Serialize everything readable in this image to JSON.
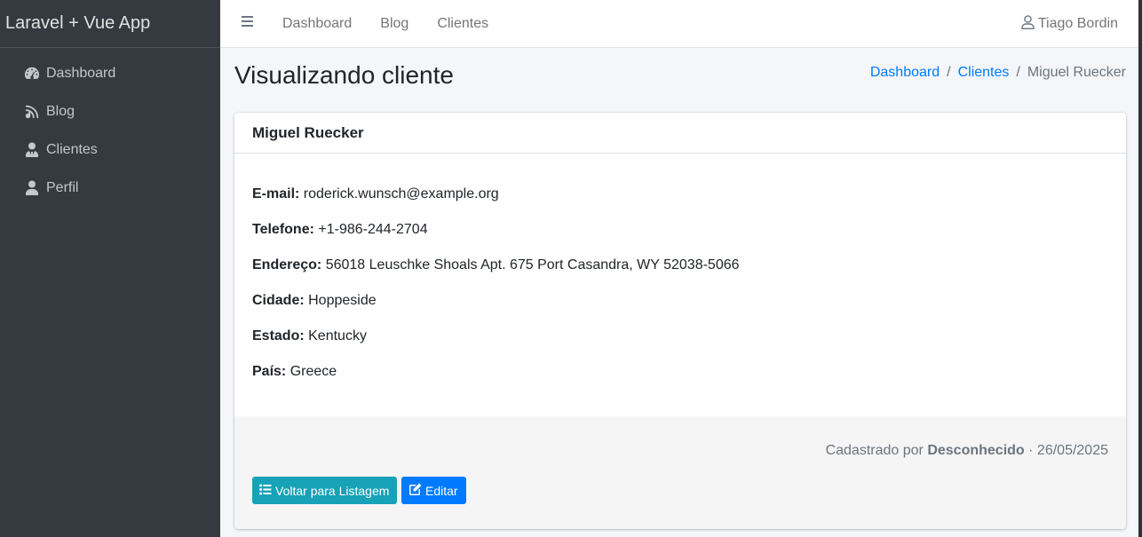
{
  "brand": "Laravel + Vue App",
  "sidebar": {
    "items": [
      {
        "label": "Dashboard",
        "icon": "tachometer-icon"
      },
      {
        "label": "Blog",
        "icon": "blog-icon"
      },
      {
        "label": "Clientes",
        "icon": "user-tie-icon"
      },
      {
        "label": "Perfil",
        "icon": "user-icon"
      }
    ]
  },
  "topnav": {
    "links": [
      "Dashboard",
      "Blog",
      "Clientes"
    ],
    "user": "Tiago Bordin"
  },
  "page": {
    "title": "Visualizando cliente",
    "breadcrumb": [
      "Dashboard",
      "Clientes",
      "Miguel Ruecker"
    ]
  },
  "client": {
    "name": "Miguel Ruecker",
    "fields": [
      {
        "label": "E-mail:",
        "value": "roderick.wunsch@example.org"
      },
      {
        "label": "Telefone:",
        "value": "+1-986-244-2704"
      },
      {
        "label": "Endereço:",
        "value": "56018 Leuschke Shoals Apt. 675 Port Casandra, WY 52038-5066"
      },
      {
        "label": "Cidade:",
        "value": "Hoppeside"
      },
      {
        "label": "Estado:",
        "value": "Kentucky"
      },
      {
        "label": "País:",
        "value": "Greece"
      }
    ]
  },
  "footer": {
    "registered_prefix": "Cadastrado por",
    "registered_by": "Desconhecido",
    "separator": "·",
    "date": "26/05/2025",
    "back_button": "Voltar para Listagem",
    "edit_button": "Editar"
  },
  "colors": {
    "sidebar_bg": "#343a40",
    "link": "#007bff",
    "btn_info": "#17a2b8",
    "btn_primary": "#007bff"
  }
}
